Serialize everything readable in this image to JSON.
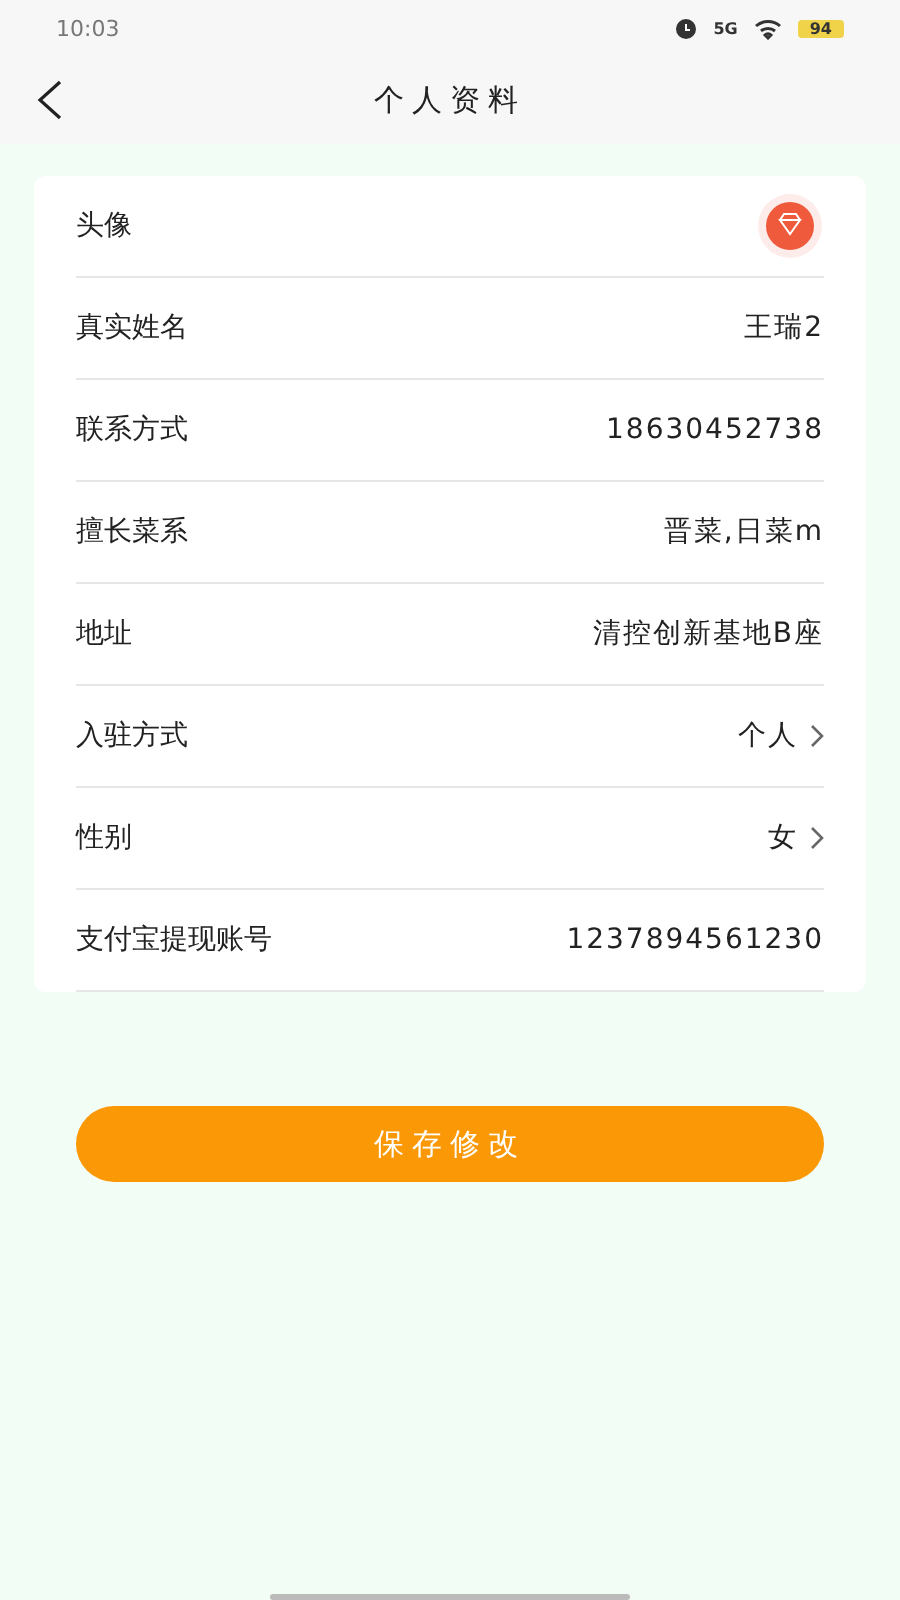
{
  "status_bar": {
    "time": "10:03",
    "network": "5G",
    "battery": "94"
  },
  "header": {
    "title": "个人资料"
  },
  "rows": [
    {
      "kind": "avatar",
      "label": "头像"
    },
    {
      "kind": "text",
      "label": "真实姓名",
      "value": "王瑞2"
    },
    {
      "kind": "text",
      "label": "联系方式",
      "value": "18630452738"
    },
    {
      "kind": "text",
      "label": "擅长菜系",
      "value": "晋菜,日菜m"
    },
    {
      "kind": "text",
      "label": "地址",
      "value": "清控创新基地B座"
    },
    {
      "kind": "select",
      "label": "入驻方式",
      "value": "个人"
    },
    {
      "kind": "select",
      "label": "性别",
      "value": "女"
    },
    {
      "kind": "text",
      "label": "支付宝提现账号",
      "value": "1237894561230"
    }
  ],
  "save_button": "保存修改"
}
